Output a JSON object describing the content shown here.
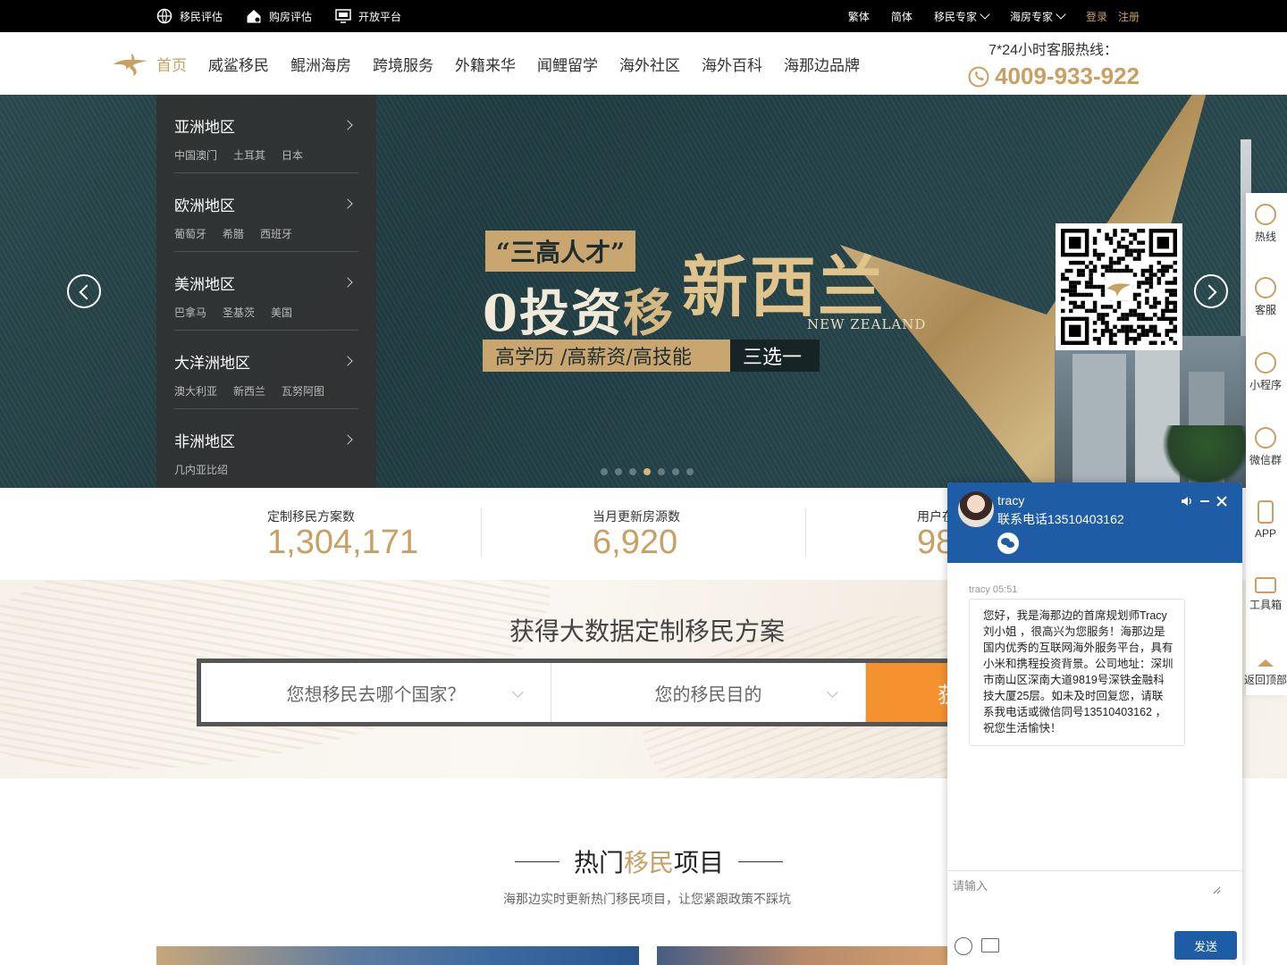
{
  "topbar": {
    "left": [
      {
        "label": "移民评估",
        "icon": "globe-icon"
      },
      {
        "label": "购房评估",
        "icon": "house-icon"
      },
      {
        "label": "开放平台",
        "icon": "monitor-icon"
      }
    ],
    "right": {
      "traditional": "繁体",
      "simplified": "简体",
      "immigration_expert": "移民专家",
      "property_expert": "海房专家",
      "login": "登录",
      "register": "注册"
    }
  },
  "nav": {
    "items": [
      "首页",
      "威鲨移民",
      "鲲洲海房",
      "跨境服务",
      "外籍来华",
      "闻鲤留学",
      "海外社区",
      "海外百科",
      "海那边品牌"
    ],
    "active_index": 0,
    "hotline_label": "7*24小时客服热线：",
    "hotline_number": "4009-933-922"
  },
  "side_menu": [
    {
      "title": "亚洲地区",
      "subs": [
        "中国澳门",
        "土耳其",
        "日本"
      ]
    },
    {
      "title": "欧洲地区",
      "subs": [
        "葡萄牙",
        "希腊",
        "西班牙"
      ]
    },
    {
      "title": "美洲地区",
      "subs": [
        "巴拿马",
        "圣基茨",
        "美国"
      ]
    },
    {
      "title": "大洋洲地区",
      "subs": [
        "澳大利亚",
        "新西兰",
        "瓦努阿图"
      ]
    },
    {
      "title": "非洲地区",
      "subs": [
        "几内亚比绍"
      ]
    }
  ],
  "banner": {
    "tag": "“三高人才”",
    "headline_a": "0投资",
    "headline_b": "移",
    "headline_big": "新西兰",
    "english": "NEW ZEALAND",
    "band_a": "高学历 /高薪资/高技能",
    "band_b": "三选一",
    "slide_count": 7,
    "active_slide": 3
  },
  "stats": [
    {
      "label": "定制移民方案数",
      "value": "1,304,171"
    },
    {
      "label": "当月更新房源数",
      "value": "6,920"
    },
    {
      "label": "用户在",
      "value": "98"
    }
  ],
  "search": {
    "title": "获得大数据定制移民方案",
    "country_placeholder": "您想移民去哪个国家？",
    "purpose_placeholder": "您的移民目的",
    "button": "获"
  },
  "hot": {
    "title_a": "热门",
    "title_b": "移民",
    "title_c": "项目",
    "subtitle": "海那边实时更新热门移民项目，让您紧跟政策不踩坑"
  },
  "right_tools": [
    "热线",
    "客服",
    "小程序",
    "微信群",
    "APP",
    "工具箱",
    "返回顶部"
  ],
  "chat": {
    "name": "tracy",
    "phone": "联系电话13510403162",
    "time": "tracy 05:51",
    "message": "您好，我是海那边的首席规划师Tracy刘小姐 ，很高兴为您服务！海那边是国内优秀的互联网海外服务平台，具有小米和携程投资背景。公司地址：深圳市南山区深南大道9819号深铁金融科技大厦25层。如未及时回复您，请联系我电话或微信同号13510403162 ，祝您生活愉快！",
    "input_placeholder": "请输入",
    "send": "发送"
  },
  "colors": {
    "gold": "#c8a063",
    "chat_blue": "#1f5ca6",
    "orange": "#f5922f"
  }
}
